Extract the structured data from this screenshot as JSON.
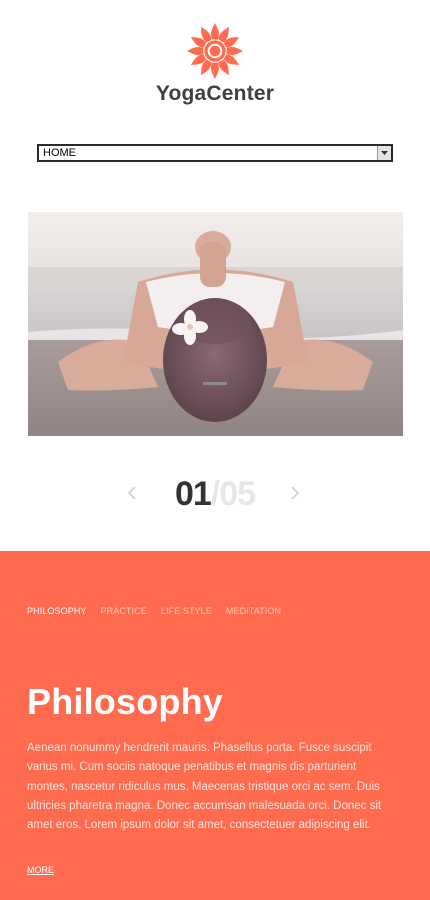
{
  "brand": {
    "name": "YogaCenter",
    "logo_icon": "sun-icon",
    "accent_color": "#ff6b4f"
  },
  "nav": {
    "selected": "HOME",
    "arrow_icon": "chevron-down-icon"
  },
  "hero": {
    "image": "woman-yoga-pose-on-beach"
  },
  "slider": {
    "current": "01",
    "separator": "/",
    "total": "05",
    "prev_icon": "chevron-left-icon",
    "next_icon": "chevron-right-icon"
  },
  "section": {
    "tabs": [
      {
        "label": "PHILOSOPHY",
        "active": true
      },
      {
        "label": "PRACTICE",
        "active": false
      },
      {
        "label": "LIFE STYLE",
        "active": false
      },
      {
        "label": "MEDITATION",
        "active": false
      }
    ],
    "title": "Philosophy",
    "body": "Aenean nonummy hendrerit mauris. Phasellus porta. Fusce suscipit varius mi. Cum sociis natoque penatibus et magnis dis parturient montes, nascetur ridiculus mus. Maecenas tristique orci ac sem. Duis ultricies pharetra magna. Donec accumsan malesuada orci. Donec sit amet eros. Lorem ipsum dolor sit amet, consectetuer adipiscing elit.",
    "more_label": "MORE",
    "background_color": "#ff6b4f"
  }
}
